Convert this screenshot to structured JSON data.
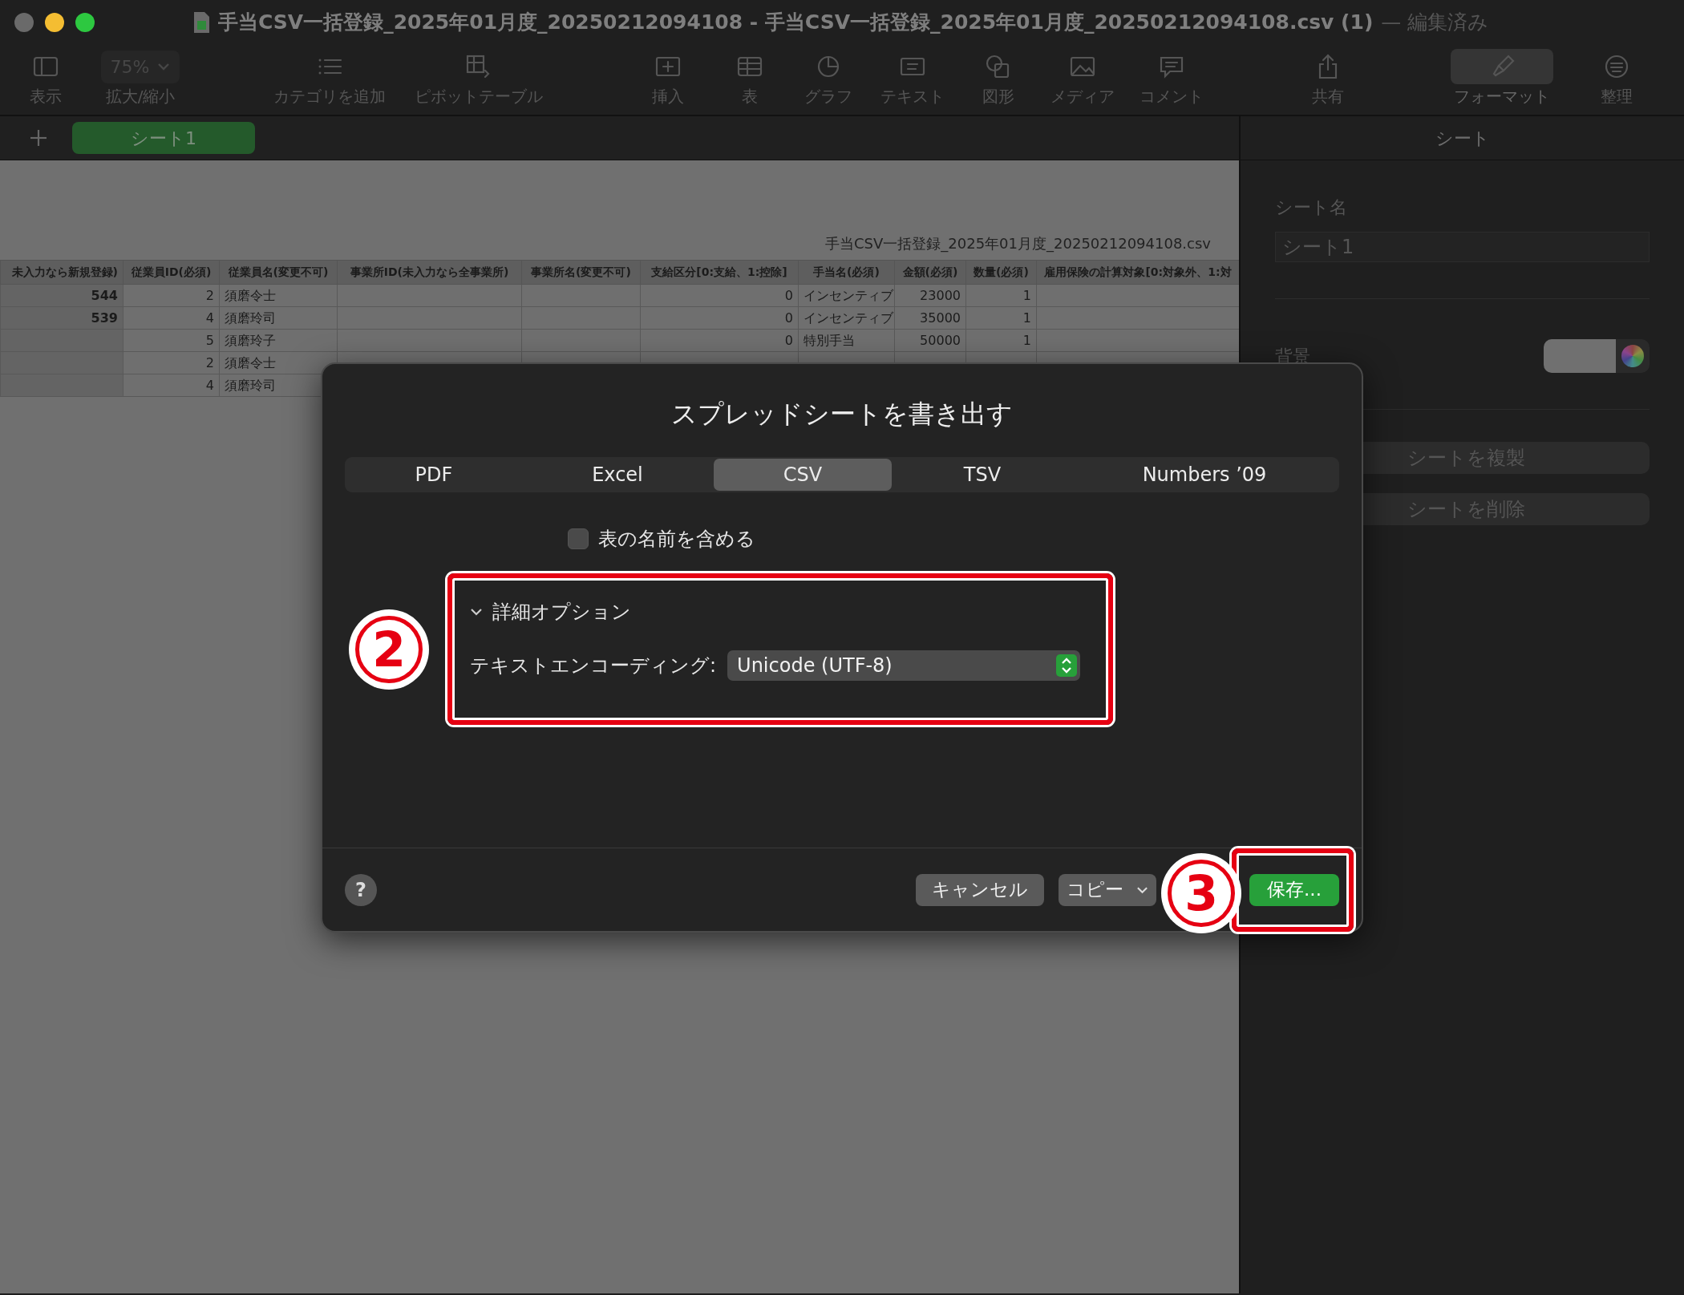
{
  "window": {
    "title": "手当CSV一括登録_2025年01月度_20250212094108 - 手当CSV一括登録_2025年01月度_20250212094108.csv (1)",
    "status": "— 編集済み"
  },
  "toolbar": [
    {
      "kind": "sidebar",
      "label": "表示",
      "selected": false
    },
    {
      "kind": "zoom",
      "value": "75%",
      "label": "拡大/縮小",
      "selected": false
    },
    {
      "kind": "list",
      "label": "カテゴリを追加",
      "selected": false
    },
    {
      "kind": "pivot",
      "label": "ピボットテーブル",
      "selected": false
    },
    {
      "kind": "insert",
      "label": "挿入",
      "selected": false
    },
    {
      "kind": "table",
      "label": "表",
      "selected": false
    },
    {
      "kind": "chart",
      "label": "グラフ",
      "selected": false
    },
    {
      "kind": "text",
      "label": "テキスト",
      "selected": false
    },
    {
      "kind": "shape",
      "label": "図形",
      "selected": false
    },
    {
      "kind": "media",
      "label": "メディア",
      "selected": false
    },
    {
      "kind": "comment",
      "label": "コメント",
      "selected": false
    },
    {
      "kind": "share",
      "label": "共有",
      "selected": false
    },
    {
      "kind": "brush",
      "label": "フォーマット",
      "selected": true
    },
    {
      "kind": "organize",
      "label": "整理",
      "selected": false
    }
  ],
  "sheet_tabs": [
    {
      "label": "シート1",
      "selected": true
    }
  ],
  "spreadsheet": {
    "caption": "手当CSV一括登録_2025年01月度_20250212094108.csv",
    "columns": [
      "未入力なら新規登録)",
      "従業員ID(必須)",
      "従業員名(変更不可)",
      "事業所ID(未入力なら全事業所)",
      "事業所名(変更不可)",
      "支給区分[0:支給、1:控除]",
      "手当名(必須)",
      "金額(必須)",
      "数量(必須)",
      "雇用保険の計算対象[0:対象外、1:対"
    ],
    "rows": [
      [
        "544",
        "2",
        "須磨令士",
        "",
        "",
        "0",
        "インセンティブ",
        "23000",
        "1",
        ""
      ],
      [
        "539",
        "4",
        "須磨玲司",
        "",
        "",
        "0",
        "インセンティブ",
        "35000",
        "1",
        ""
      ],
      [
        "",
        "5",
        "須磨玲子",
        "",
        "",
        "0",
        "特別手当",
        "50000",
        "1",
        ""
      ],
      [
        "",
        "2",
        "須磨令士"
      ],
      [
        "",
        "4",
        "須磨玲司"
      ]
    ]
  },
  "sidebar": {
    "title": "シート",
    "name_label": "シート名",
    "name_value": "シート1",
    "background_label": "背景",
    "buttons": [
      "シートを複製",
      "シートを削除"
    ]
  },
  "dialog": {
    "title": "スプレッドシートを書き出す",
    "tabs": [
      {
        "label": "PDF",
        "selected": false
      },
      {
        "label": "Excel",
        "selected": false
      },
      {
        "label": "CSV",
        "selected": true
      },
      {
        "label": "TSV",
        "selected": false
      },
      {
        "label": "Numbers ’09",
        "selected": false
      }
    ],
    "include_table_names": {
      "label": "表の名前を含める",
      "checked": false
    },
    "advanced": {
      "label": "詳細オプション",
      "expanded": true,
      "encoding_label": "テキストエンコーディング:",
      "encoding_value": "Unicode (UTF-8)"
    },
    "help": "?",
    "buttons": [
      {
        "kind": "plain",
        "label": "キャンセル"
      },
      {
        "kind": "menu",
        "label": "コピー"
      },
      {
        "kind": "primary",
        "label": "保存..."
      }
    ]
  },
  "annotations": [
    {
      "number": "2"
    },
    {
      "number": "3"
    }
  ]
}
